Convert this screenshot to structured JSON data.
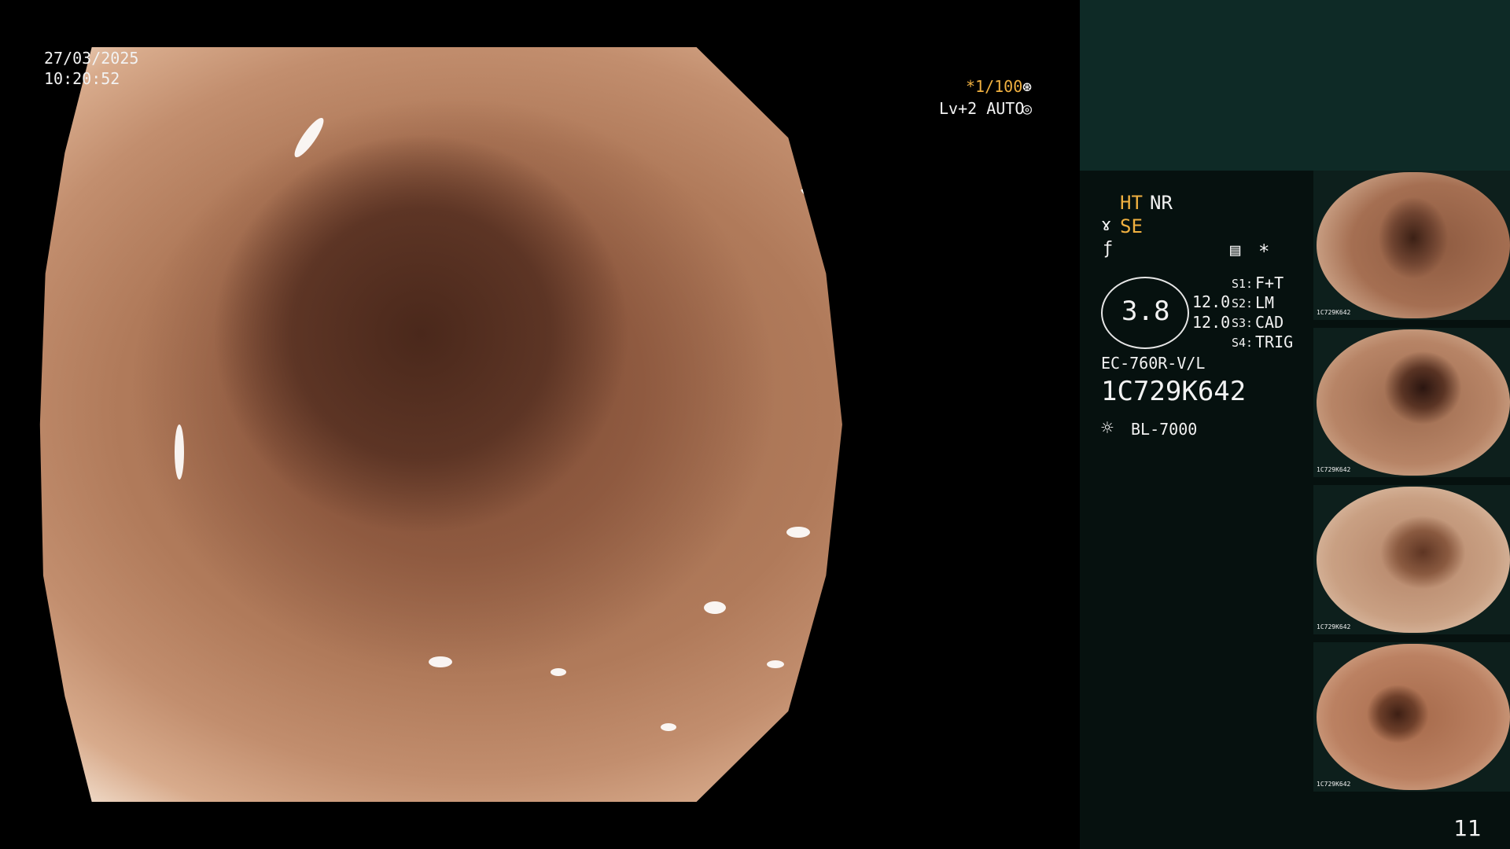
{
  "overlay": {
    "date": "27/03/2025",
    "time": "10:20:52",
    "shutter": "*1/100",
    "exposure": "Lv+2 AUTO"
  },
  "settings": {
    "ht": "HT",
    "nr": "NR",
    "se": "SE",
    "gauge_value": "3.8",
    "value_a": "12.0",
    "value_b": "12.0",
    "s1": "S1:",
    "s1_val": "F+T",
    "s2": "S2:",
    "s2_val": "LM",
    "s3": "S3:",
    "s3_val": "CAD",
    "s4": "S4:",
    "s4_val": "TRIG",
    "asterisk": "*",
    "scope_model": "EC-760R-V/L",
    "serial": "1C729K642",
    "light_source": "BL-7000"
  },
  "thumbnails": [
    {
      "serial": "1C729K642"
    },
    {
      "serial": "1C729K642"
    },
    {
      "serial": "1C729K642"
    },
    {
      "serial": "1C729K642"
    }
  ],
  "page_number": "11",
  "colors": {
    "accent": "#f0b040",
    "panel_top": "#0e2a26",
    "panel_body": "#06110f"
  },
  "icons": [
    "shutter-mode-icon",
    "auto-iris-icon",
    "structure-icon",
    "color-icon",
    "memory-icon",
    "light-source-icon"
  ]
}
